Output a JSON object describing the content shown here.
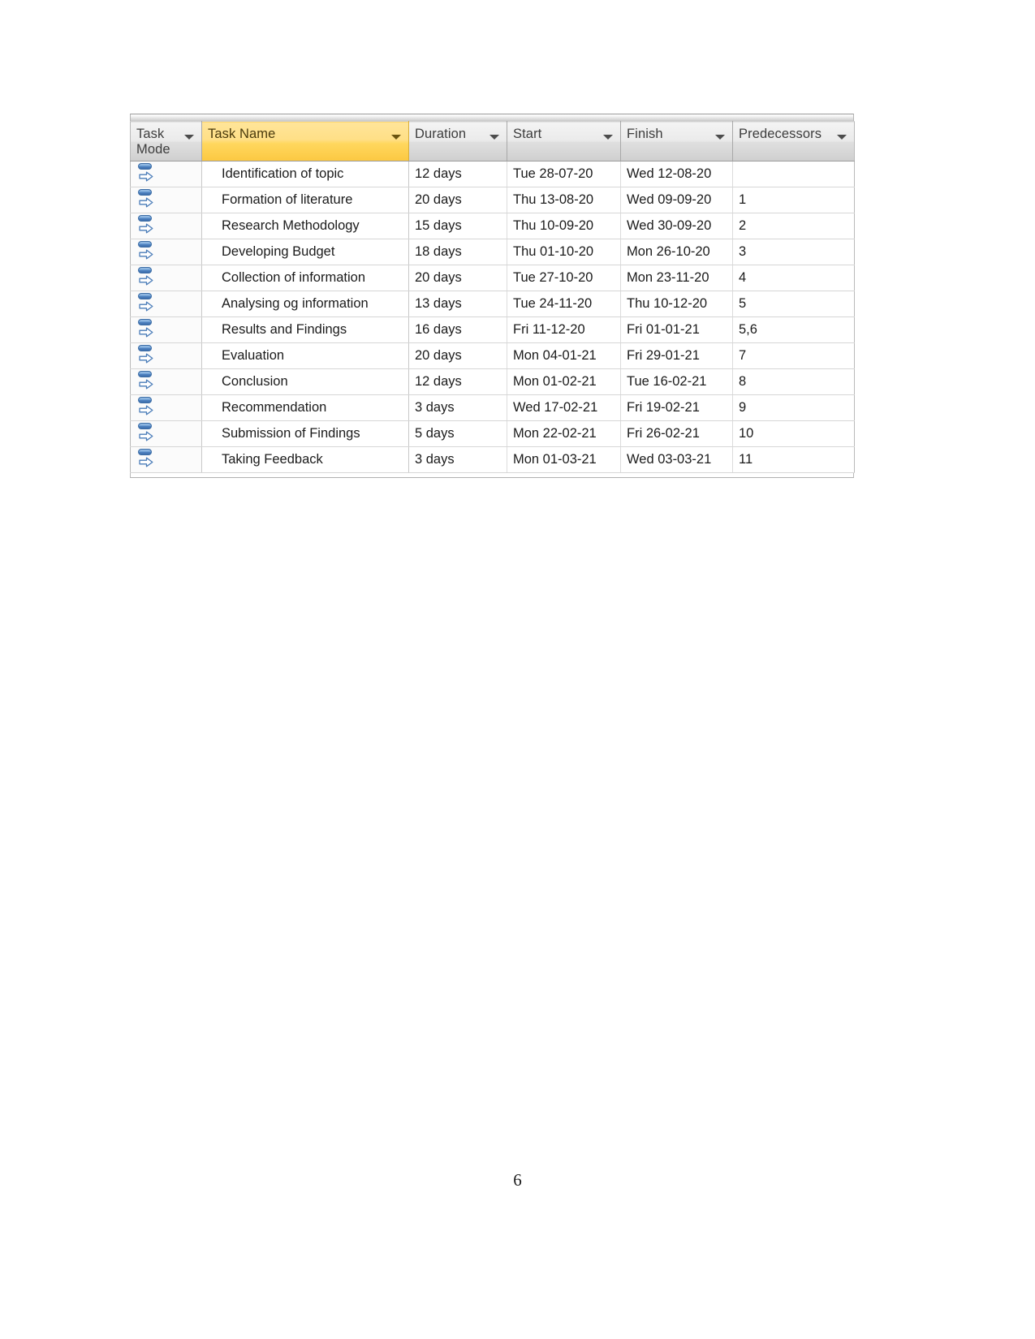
{
  "document": {
    "page_number": "6"
  },
  "table": {
    "columns": [
      {
        "id": "task_mode",
        "label": "Task Mode",
        "has_filter": true,
        "highlighted": false
      },
      {
        "id": "task_name",
        "label": "Task Name",
        "has_filter": true,
        "highlighted": true
      },
      {
        "id": "duration",
        "label": "Duration",
        "has_filter": true,
        "highlighted": false
      },
      {
        "id": "start",
        "label": "Start",
        "has_filter": true,
        "highlighted": false
      },
      {
        "id": "finish",
        "label": "Finish",
        "has_filter": true,
        "highlighted": false
      },
      {
        "id": "predecessors",
        "label": "Predecessors",
        "has_filter": true,
        "highlighted": false
      }
    ],
    "row_icon": "auto-scheduled-task-icon",
    "rows": [
      {
        "mode_icon": "auto-scheduled-task-icon",
        "task_name": "Identification of topic",
        "duration": "12 days",
        "start": "Tue 28-07-20",
        "finish": "Wed 12-08-20",
        "predecessors": ""
      },
      {
        "mode_icon": "auto-scheduled-task-icon",
        "task_name": "Formation of literature",
        "duration": "20 days",
        "start": "Thu 13-08-20",
        "finish": "Wed 09-09-20",
        "predecessors": "1"
      },
      {
        "mode_icon": "auto-scheduled-task-icon",
        "task_name": "Research Methodology",
        "duration": "15 days",
        "start": "Thu 10-09-20",
        "finish": "Wed 30-09-20",
        "predecessors": "2"
      },
      {
        "mode_icon": "auto-scheduled-task-icon",
        "task_name": "Developing Budget",
        "duration": "18 days",
        "start": "Thu 01-10-20",
        "finish": "Mon 26-10-20",
        "predecessors": "3"
      },
      {
        "mode_icon": "auto-scheduled-task-icon",
        "task_name": "Collection of information",
        "duration": "20 days",
        "start": "Tue 27-10-20",
        "finish": "Mon 23-11-20",
        "predecessors": "4"
      },
      {
        "mode_icon": "auto-scheduled-task-icon",
        "task_name": "Analysing og information",
        "duration": "13 days",
        "start": "Tue 24-11-20",
        "finish": "Thu 10-12-20",
        "predecessors": "5"
      },
      {
        "mode_icon": "auto-scheduled-task-icon",
        "task_name": "Results and Findings",
        "duration": "16 days",
        "start": "Fri 11-12-20",
        "finish": "Fri 01-01-21",
        "predecessors": "5,6"
      },
      {
        "mode_icon": "auto-scheduled-task-icon",
        "task_name": "Evaluation",
        "duration": "20 days",
        "start": "Mon 04-01-21",
        "finish": "Fri 29-01-21",
        "predecessors": "7"
      },
      {
        "mode_icon": "auto-scheduled-task-icon",
        "task_name": "Conclusion",
        "duration": "12 days",
        "start": "Mon 01-02-21",
        "finish": "Tue 16-02-21",
        "predecessors": "8"
      },
      {
        "mode_icon": "auto-scheduled-task-icon",
        "task_name": "Recommendation",
        "duration": "3 days",
        "start": "Wed 17-02-21",
        "finish": "Fri 19-02-21",
        "predecessors": "9"
      },
      {
        "mode_icon": "auto-scheduled-task-icon",
        "task_name": "Submission of Findings",
        "duration": "5 days",
        "start": "Mon 22-02-21",
        "finish": "Fri 26-02-21",
        "predecessors": "10"
      },
      {
        "mode_icon": "auto-scheduled-task-icon",
        "task_name": "Taking Feedback",
        "duration": "3 days",
        "start": "Mon 01-03-21",
        "finish": "Wed 03-03-21",
        "predecessors": "11"
      }
    ]
  },
  "colors": {
    "header_highlight": "#ffd75e",
    "header_default": "#dfdfdf",
    "icon_blue": "#4b7fbe",
    "grid_line": "#d6d6d6",
    "text": "#1b1b1b"
  }
}
